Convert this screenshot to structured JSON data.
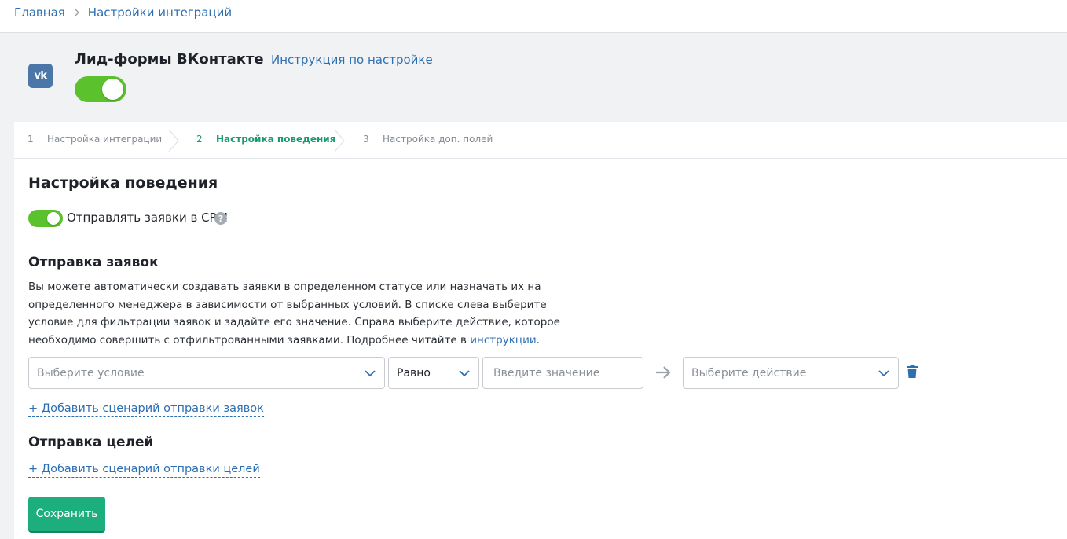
{
  "breadcrumb": {
    "home": "Главная",
    "current": "Настройки интеграций"
  },
  "integration": {
    "logo_text": "vk",
    "title": "Лид-формы ВКонтакте",
    "instruction_link": "Инструкция по настройке",
    "enabled": true
  },
  "steps": [
    {
      "num": "1",
      "label": "Настройка интеграции",
      "active": false
    },
    {
      "num": "2",
      "label": "Настройка поведения",
      "active": true
    },
    {
      "num": "3",
      "label": "Настройка доп. полей",
      "active": false
    }
  ],
  "behavior": {
    "title": "Настройка поведения",
    "crm_toggle_label": "Отправлять заявки в CRM",
    "crm_enabled": true,
    "help_icon": "?"
  },
  "requests": {
    "title": "Отправка заявок",
    "description": "Вы можете автоматически создавать заявки в определенном статусе или назначать их на определенного менеджера в зависимости от выбранных условий. В списке слева выберите условие для фильтрации заявок и задайте его значение. Справа выберите действие, которое необходимо совершить с отфильтрованными заявками. Подробнее читайте в ",
    "description_link": "инструкции",
    "description_end": ".",
    "condition_placeholder": "Выберите условие",
    "operator_value": "Равно",
    "value_placeholder": "Введите значение",
    "action_placeholder": "Выберите действие",
    "add_link": "+ Добавить сценарий отправки заявок"
  },
  "goals": {
    "title": "Отправка целей",
    "add_link": "+ Добавить сценарий отправки целей"
  },
  "save_label": "Сохранить",
  "colors": {
    "accent": "#2c6fb2",
    "toggle_on": "#5bc12d",
    "active_step": "#1a9a6c",
    "save_button": "#1dae7e",
    "vk_brand": "#4a76a8"
  },
  "icons": {
    "breadcrumb_separator": "chevron-right-icon",
    "select_chevron": "chevron-down-icon",
    "arrow": "arrow-right-icon",
    "delete": "trash-icon",
    "help": "question-circle-icon"
  }
}
